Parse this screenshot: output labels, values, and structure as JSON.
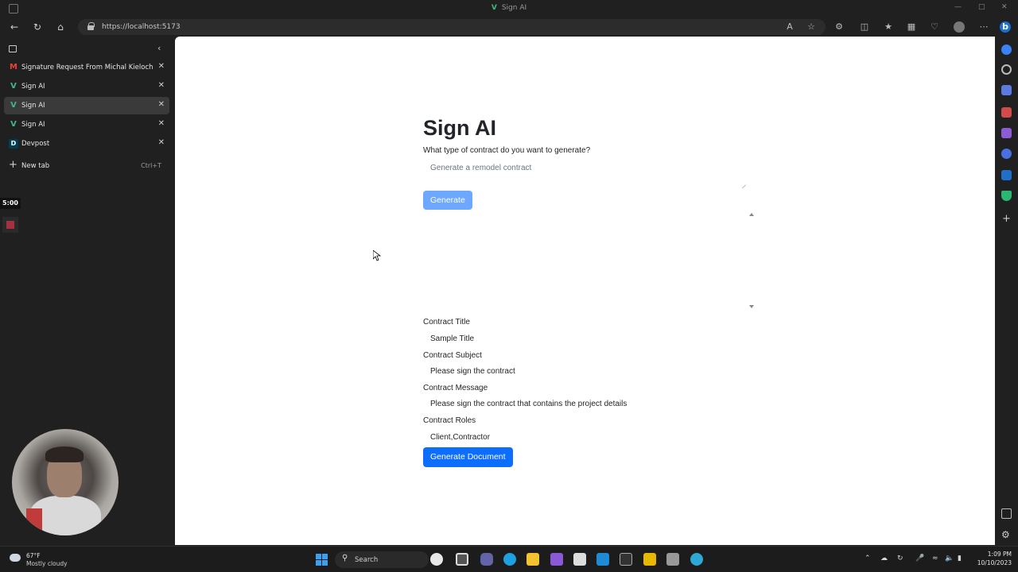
{
  "window": {
    "title": "Sign AI"
  },
  "toolbar": {
    "url": "https://localhost:5173"
  },
  "tabs": {
    "items": [
      {
        "label": "Signature Request From Michal Kieloch - mkiel",
        "favicon": "gmail-icon"
      },
      {
        "label": "Sign AI",
        "favicon": "vue-icon"
      },
      {
        "label": "Sign AI",
        "favicon": "vue-icon"
      },
      {
        "label": "Sign AI",
        "favicon": "vue-icon"
      },
      {
        "label": "Devpost",
        "favicon": "devpost-icon"
      }
    ],
    "active_index": 2,
    "new_tab_label": "New tab",
    "new_tab_shortcut": "Ctrl+T"
  },
  "recorder": {
    "timer": "5:00"
  },
  "page": {
    "title": "Sign AI",
    "prompt_label": "What type of contract do you want to generate?",
    "prompt_placeholder": "Generate a remodel contract",
    "generate_label": "Generate",
    "fields": [
      {
        "label": "Contract Title",
        "value": "Sample Title"
      },
      {
        "label": "Contract Subject",
        "value": "Please sign the contract"
      },
      {
        "label": "Contract Message",
        "value": "Please sign the contract that contains the project details"
      },
      {
        "label": "Contract Roles",
        "value": "Client,Contractor"
      }
    ],
    "generate_document_label": "Generate Document"
  },
  "taskbar": {
    "weather_temp": "67°F",
    "weather_condition": "Mostly cloudy",
    "search_label": "Search",
    "time": "1:09 PM",
    "date": "10/10/2023"
  },
  "colors": {
    "primary": "#0d6efd",
    "primary_disabled": "#6ea8fe",
    "vue_green": "#41b883"
  }
}
